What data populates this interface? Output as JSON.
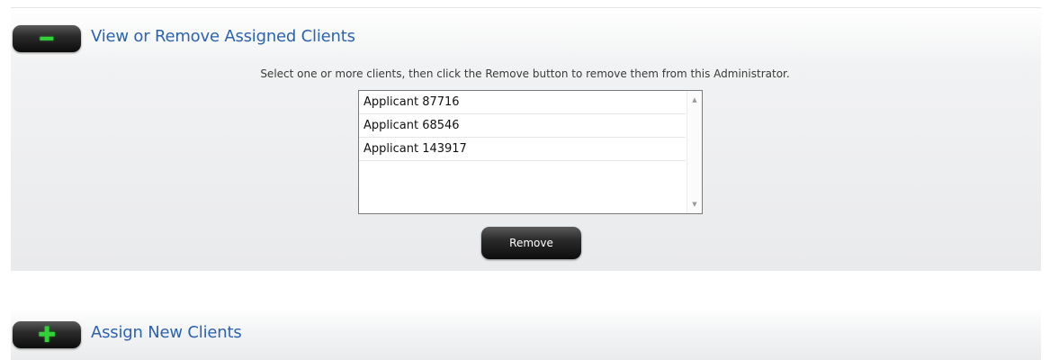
{
  "sections": {
    "view_remove": {
      "toggle_icon": "minus-icon",
      "toggle_glyph": "━",
      "title": "View or Remove Assigned Clients",
      "instructions": "Select one or more clients, then click the Remove button to remove them from this Administrator.",
      "clients": [
        {
          "label": "Applicant 87716"
        },
        {
          "label": "Applicant 68546"
        },
        {
          "label": "Applicant 143917"
        }
      ],
      "remove_label": "Remove"
    },
    "assign_new": {
      "toggle_icon": "plus-icon",
      "toggle_glyph": "✚",
      "title": "Assign New Clients"
    }
  },
  "scrollbar": {
    "up_arrow": "▲",
    "down_arrow": "▼"
  },
  "colors": {
    "title_blue": "#2c63b0",
    "toggle_glyph_green": "#32d13a",
    "button_dark": "#1a1a1a",
    "panel_gray": "#e9eaec"
  }
}
